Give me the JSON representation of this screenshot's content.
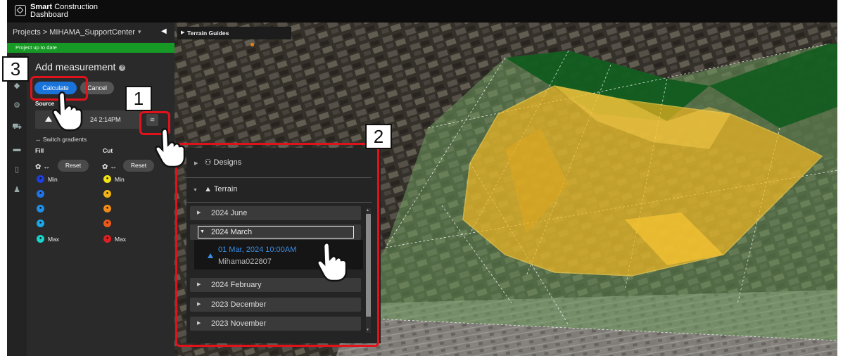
{
  "app": {
    "brand_bold": "Smart",
    "brand_rest": "Construction",
    "brand_line2": "Dashboard"
  },
  "project": {
    "crumb": "Projects > MIHAMA_SupportCenter",
    "status": "Project up to date"
  },
  "panel": {
    "heading": "Add measurement",
    "calculate_label": "Calculate",
    "cancel_label": "Cancel",
    "source_label": "Source",
    "source_value": "24 2:14PM",
    "switch_label": "Switch gradients",
    "fill_label": "Fill",
    "cut_label": "Cut",
    "reset_label": "Reset",
    "min_label": "Min",
    "max_label": "Max"
  },
  "map": {
    "terrain_guides": "Terrain Guides"
  },
  "dropdown": {
    "designs": "Designs",
    "terrain": "Terrain",
    "years": [
      "2024 June",
      "2024 March",
      "2024 February",
      "2023 December",
      "2023 November"
    ],
    "entry_date": "01 Mar, 2024 10:00AM",
    "entry_name": "Mihama022807"
  },
  "annotations": {
    "n1": "1",
    "n2": "2",
    "n3": "3"
  },
  "colors": {
    "accent": "#1a73d9",
    "status_green": "#169a25",
    "highlight": "#e0131c",
    "entry_blue": "#3b8fe8"
  }
}
